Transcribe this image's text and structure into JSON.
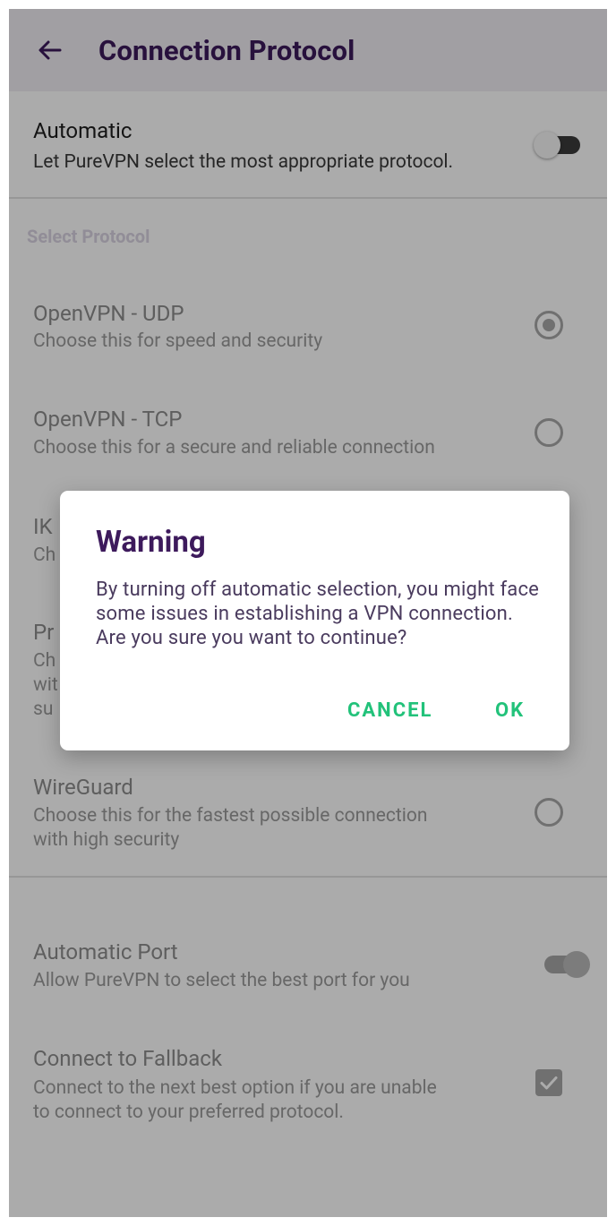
{
  "appbar": {
    "title": "Connection Protocol",
    "back_icon": "arrow-left-icon",
    "background": "#f1eef4",
    "title_color": "#3d1a5c"
  },
  "automatic": {
    "title": "Automatic",
    "subtitle": "Let PureVPN select the most appropriate protocol.",
    "toggle_on": false
  },
  "section": {
    "label": "Select Protocol"
  },
  "protocols": [
    {
      "title": "OpenVPN - UDP",
      "subtitle": "Choose this for speed and security",
      "selected": true
    },
    {
      "title": "OpenVPN - TCP",
      "subtitle": "Choose this for a secure and reliable connection",
      "selected": false
    },
    {
      "title": "IK",
      "subtitle": "Ch",
      "selected": false
    },
    {
      "title": "Pr",
      "subtitle_lines": [
        "Ch",
        "wit",
        "su"
      ],
      "selected": false
    },
    {
      "title": "WireGuard",
      "subtitle_lines": [
        "Choose this for the fastest possible connection",
        "with high security"
      ],
      "selected": false
    }
  ],
  "automatic_port": {
    "title": "Automatic Port",
    "subtitle": "Allow PureVPN to select the best port for you",
    "toggle_on": true
  },
  "fallback": {
    "title": "Connect to Fallback",
    "subtitle_lines": [
      "Connect to the next best option if you are unable",
      "to connect to your preferred protocol."
    ],
    "checked": true
  },
  "dialog": {
    "title": "Warning",
    "message": "By turning off automatic selection, you might face some issues in establishing a VPN connection. Are you sure you want to continue?",
    "cancel_label": "CANCEL",
    "ok_label": "OK",
    "accent": "#22c27a"
  }
}
